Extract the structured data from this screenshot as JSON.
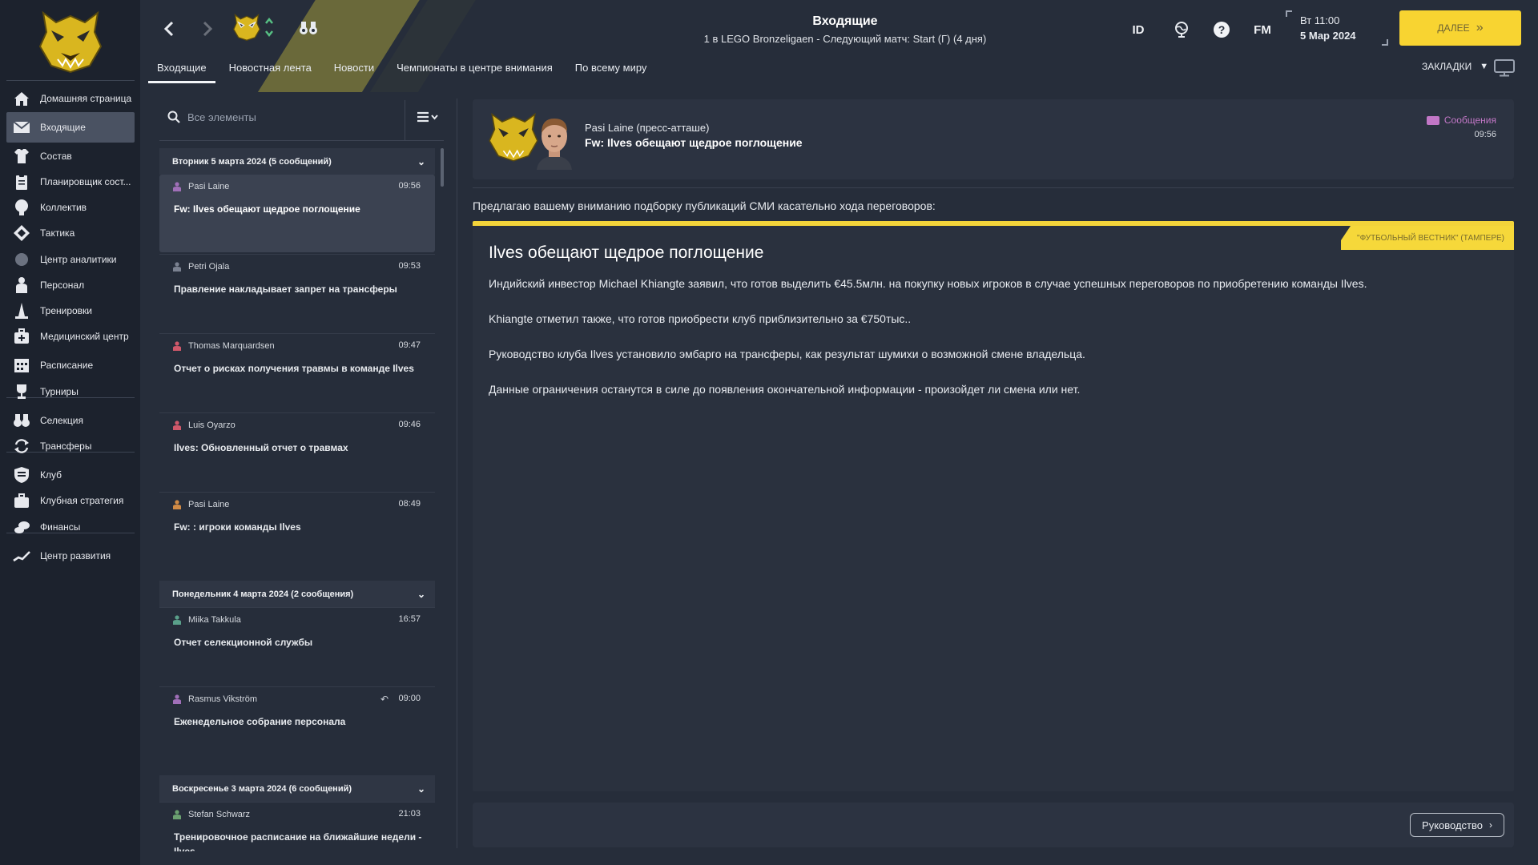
{
  "colors": {
    "accent": "#f8d431",
    "sidebar_bg": "#1c222d",
    "panel_bg": "#262d3a",
    "tag_pink": "#c277c6"
  },
  "sidebar": {
    "items": [
      {
        "label": "Домашняя страница",
        "icon": "home-icon"
      },
      {
        "label": "Входящие",
        "icon": "mail-icon",
        "active": true
      },
      {
        "label": "Состав",
        "icon": "shirt-icon"
      },
      {
        "label": "Планировщик сост...",
        "icon": "clipboard-icon"
      },
      {
        "label": "Коллектив",
        "icon": "brain-icon"
      },
      {
        "label": "Тактика",
        "icon": "tactics-icon"
      },
      {
        "label": "Центр аналитики",
        "icon": "circle-icon"
      },
      {
        "label": "Персонал",
        "icon": "person-icon"
      },
      {
        "label": "Тренировки",
        "icon": "cone-icon"
      },
      {
        "label": "Медицинский центр",
        "icon": "medkit-icon"
      },
      {
        "label": "Расписание",
        "icon": "calendar-icon"
      },
      {
        "label": "Турниры",
        "icon": "trophy-icon"
      },
      {
        "label": "Селекция",
        "icon": "binoculars-icon"
      },
      {
        "label": "Трансферы",
        "icon": "transfer-icon"
      },
      {
        "label": "Клуб",
        "icon": "shield-icon"
      },
      {
        "label": "Клубная стратегия",
        "icon": "briefcase-icon"
      },
      {
        "label": "Финансы",
        "icon": "money-icon"
      },
      {
        "label": "Центр развития",
        "icon": "growth-icon"
      }
    ]
  },
  "header": {
    "title": "Входящие",
    "subtitle": "1 в LEGO Bronzeligaen - Следующий матч: Start (Г) (4 дня)",
    "id_label": "ID",
    "fm_label": "FM",
    "day_time": "Вт 11:00",
    "date": "5 Мар 2024",
    "continue_label": "ДАЛЕЕ",
    "bookmarks_label": "ЗАКЛАДКИ"
  },
  "tabs": [
    {
      "label": "Входящие",
      "active": true
    },
    {
      "label": "Новостная лента"
    },
    {
      "label": "Новости"
    },
    {
      "label": "Чемпионаты в центре внимания"
    },
    {
      "label": "По всему миру"
    }
  ],
  "list": {
    "search_placeholder": "Все элементы",
    "groups": [
      {
        "title": "Вторник 5 марта 2024 (5 сообщений)",
        "messages": [
          {
            "sender": "Pasi Laine",
            "time": "09:56",
            "subject": "Fw: Ilves обещают щедрое поглощение",
            "person_color": "#a06fb8",
            "selected": true
          },
          {
            "sender": "Petri Ojala",
            "time": "09:53",
            "subject": "Правление накладывает запрет на трансферы",
            "person_color": "#7a8190"
          },
          {
            "sender": "Thomas Marquardsen",
            "time": "09:47",
            "subject": "Отчет о рисках получения травмы в команде Ilves",
            "person_color": "#d0586a"
          },
          {
            "sender": "Luis Oyarzo",
            "time": "09:46",
            "subject": "Ilves: Обновленный отчет о травмах",
            "person_color": "#d0586a"
          },
          {
            "sender": "Pasi Laine",
            "time": "08:49",
            "subject": "Fw: : игроки команды Ilves",
            "person_color": "#d08a45"
          }
        ]
      },
      {
        "title": "Понедельник 4 марта 2024 (2 сообщения)",
        "messages": [
          {
            "sender": "Miika Takkula",
            "time": "16:57",
            "subject": "Отчет селекционной службы",
            "person_color": "#5aa08a"
          },
          {
            "sender": "Rasmus Vikström",
            "time": "09:00",
            "subject": "Еженедельное собрание персонала",
            "person_color": "#a06fb8",
            "replied": true
          }
        ]
      },
      {
        "title": "Воскресенье 3 марта 2024 (6 сообщений)",
        "messages": [
          {
            "sender": "Stefan Schwarz",
            "time": "21:03",
            "subject": "Тренировочное расписание на ближайшие недели - Ilves",
            "person_color": "#6aa070"
          }
        ]
      }
    ]
  },
  "reader": {
    "from": "Pasi Laine  (пресс-атташе)",
    "subject": "Fw: Ilves обещают щедрое поглощение",
    "tag": "Сообщения",
    "time": "09:56",
    "intro": "Предлагаю вашему вниманию подборку публикаций СМИ касательно хода переговоров:",
    "source": "\"ФУТБОЛЬНЫЙ ВЕСТНИК\" (ТАМПЕРЕ)",
    "article_title": "Ilves обещают щедрое поглощение",
    "paragraphs": [
      "Индийский инвестор Michael Khiangte заявил, что готов выделить €45.5млн. на покупку новых игроков в случае успешных переговоров по приобретению команды Ilves.",
      "Khiangte отметил также, что готов приобрести клуб приблизительно за €750тыс..",
      "Руководство клуба Ilves установило эмбарго на трансферы, как результат шумихи о возможной смене владельца.",
      "Данные ограничения останутся в силе до появления окончательной информации - произойдет ли смена или нет."
    ],
    "manual_label": "Руководство"
  }
}
